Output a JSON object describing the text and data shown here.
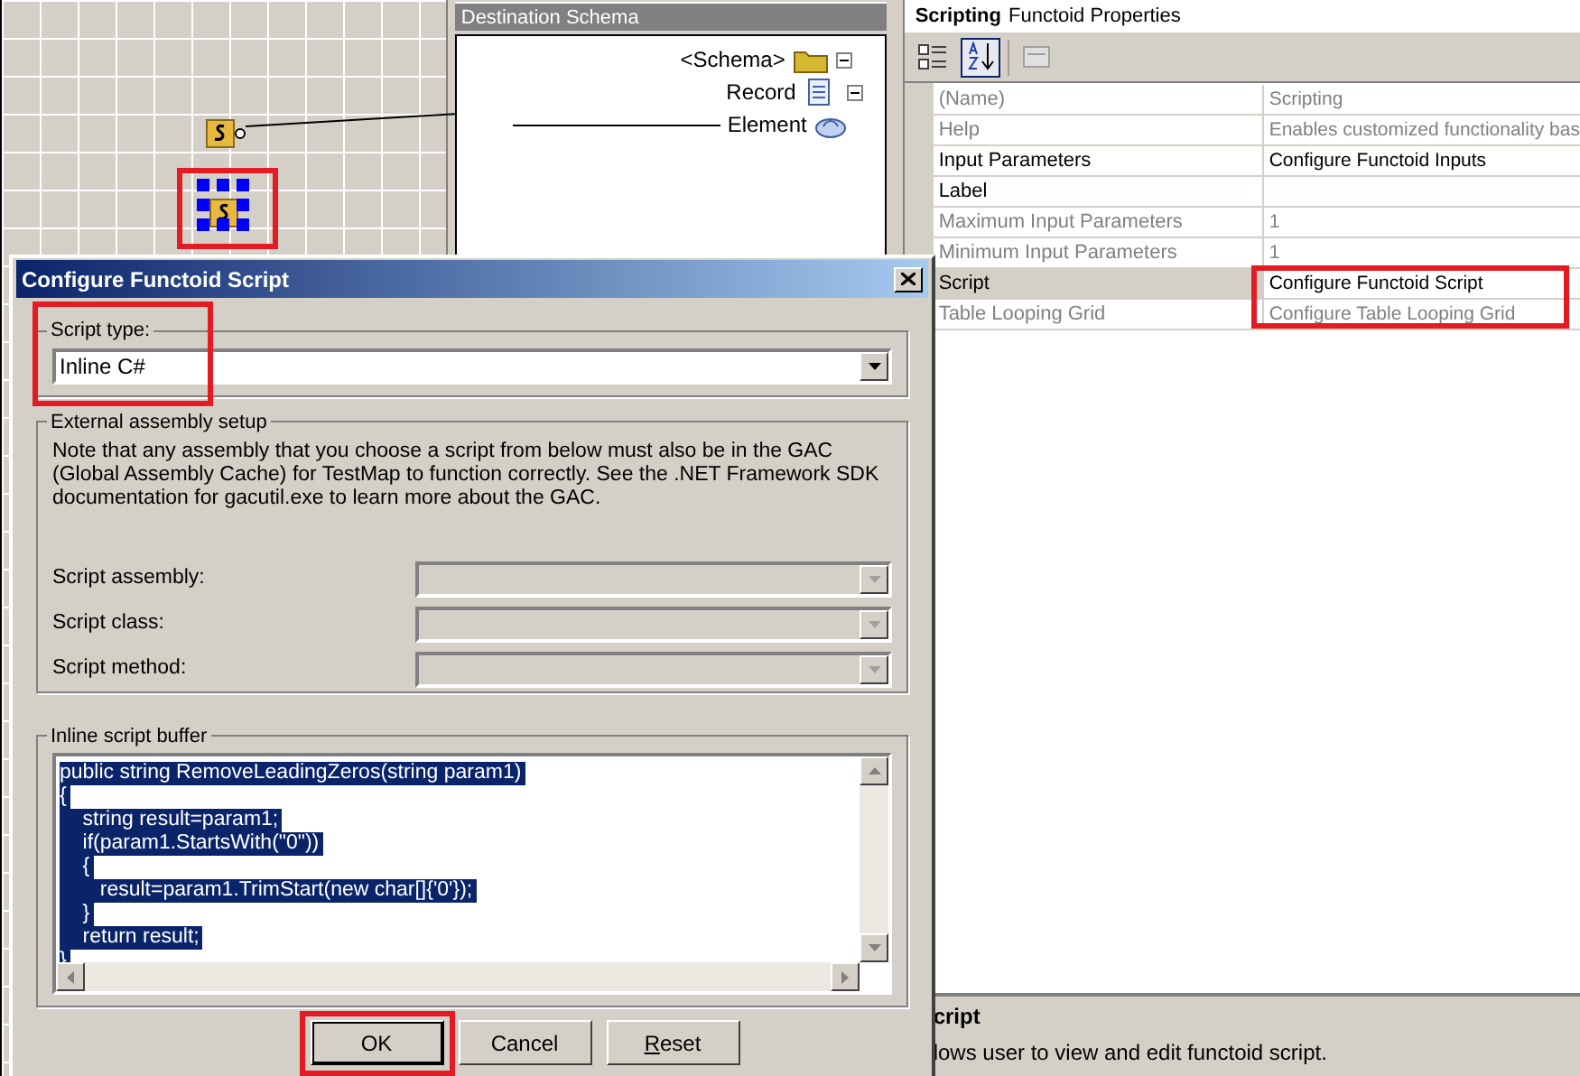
{
  "destination_schema": {
    "title": "Destination Schema",
    "nodes": [
      {
        "label": "<Schema>",
        "kind": "schema",
        "expanded": true
      },
      {
        "label": "Record",
        "kind": "record",
        "expanded": true
      },
      {
        "label": "Element",
        "kind": "element",
        "linked": true
      }
    ]
  },
  "canvas": {
    "functoids": [
      {
        "selected": false,
        "linked": true
      },
      {
        "selected": true,
        "linked": false
      }
    ]
  },
  "properties": {
    "title_bold": "Scripting",
    "title": "Functoid Properties",
    "toolbar": [
      {
        "kind": "categorized",
        "selected": false
      },
      {
        "kind": "alphabetical",
        "selected": true
      },
      {
        "kind": "pages",
        "selected": false
      }
    ],
    "rows": [
      {
        "name": "(Name)",
        "value": "Scripting",
        "disabled": true,
        "selected": false
      },
      {
        "name": "Help",
        "value": "Enables customized functionality bas",
        "disabled": true,
        "selected": false
      },
      {
        "name": "Input Parameters",
        "value": "Configure Functoid Inputs",
        "disabled": false,
        "selected": false
      },
      {
        "name": "Label",
        "value": "",
        "disabled": false,
        "selected": false
      },
      {
        "name": "Maximum Input Parameters",
        "value": "1",
        "disabled": true,
        "selected": false
      },
      {
        "name": "Minimum Input Parameters",
        "value": "1",
        "disabled": true,
        "selected": false
      },
      {
        "name": "Script",
        "value": "Configure Functoid Script",
        "disabled": false,
        "selected": true
      },
      {
        "name": "Table Looping Grid",
        "value": "Configure Table Looping Grid",
        "disabled": true,
        "selected": false
      }
    ],
    "description_title": "cript",
    "description": "lows user to view and edit functoid script."
  },
  "dialog": {
    "title": "Configure Functoid Script",
    "script_type": {
      "label": "Script type:",
      "value": "Inline C#"
    },
    "external": {
      "label": "External assembly setup",
      "note": "Note that any assembly that you choose a script from below must also be in the GAC (Global Assembly Cache) for TestMap to function correctly.  See the .NET Framework SDK documentation for gacutil.exe to learn more about the GAC.",
      "fields": [
        {
          "label": "Script assembly:",
          "disabled": true
        },
        {
          "label": "Script class:",
          "disabled": true
        },
        {
          "label": "Script method:",
          "disabled": true
        }
      ]
    },
    "buffer": {
      "label": "Inline script buffer",
      "selected": true,
      "lines": [
        "public string RemoveLeadingZeros(string param1)",
        "{",
        "    string result=param1;",
        "    if(param1.StartsWith(\"0\"))",
        "    {",
        "       result=param1.TrimStart(new char[]{'0'});",
        "    }",
        "    return result;",
        "}"
      ]
    },
    "buttons": [
      {
        "label": "OK",
        "default": true,
        "mnemonic": false
      },
      {
        "label": "Cancel",
        "default": false,
        "mnemonic": false
      },
      {
        "label": "Reset",
        "default": false,
        "mnemonic": true
      }
    ]
  }
}
